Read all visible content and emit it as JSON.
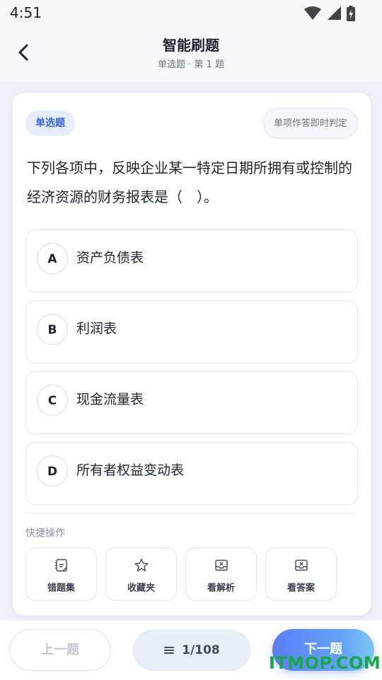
{
  "status_bar": {
    "time": "4:51"
  },
  "header": {
    "title": "智能刷题",
    "subtitle": "单选题 · 第 1 题"
  },
  "card": {
    "badge": "单选题",
    "mode": "单项作答即时判定",
    "question": "下列各项中，反映企业某一特定日期所拥有或控制的经济资源的财务报表是（　）。",
    "options": [
      {
        "letter": "A",
        "text": "资产负债表"
      },
      {
        "letter": "B",
        "text": "利润表"
      },
      {
        "letter": "C",
        "text": "现金流量表"
      },
      {
        "letter": "D",
        "text": "所有者权益变动表"
      }
    ],
    "quick_actions_label": "快捷操作",
    "quick_actions": [
      {
        "label": "错题集",
        "icon": "notebook-icon"
      },
      {
        "label": "收藏夹",
        "icon": "star-icon"
      },
      {
        "label": "看解析",
        "icon": "inbox-icon"
      },
      {
        "label": "看答案",
        "icon": "inbox-icon"
      }
    ]
  },
  "bottom_bar": {
    "prev": "上一题",
    "progress": "1/108",
    "next": "下一题"
  },
  "watermark": "ITMOP.COM"
}
